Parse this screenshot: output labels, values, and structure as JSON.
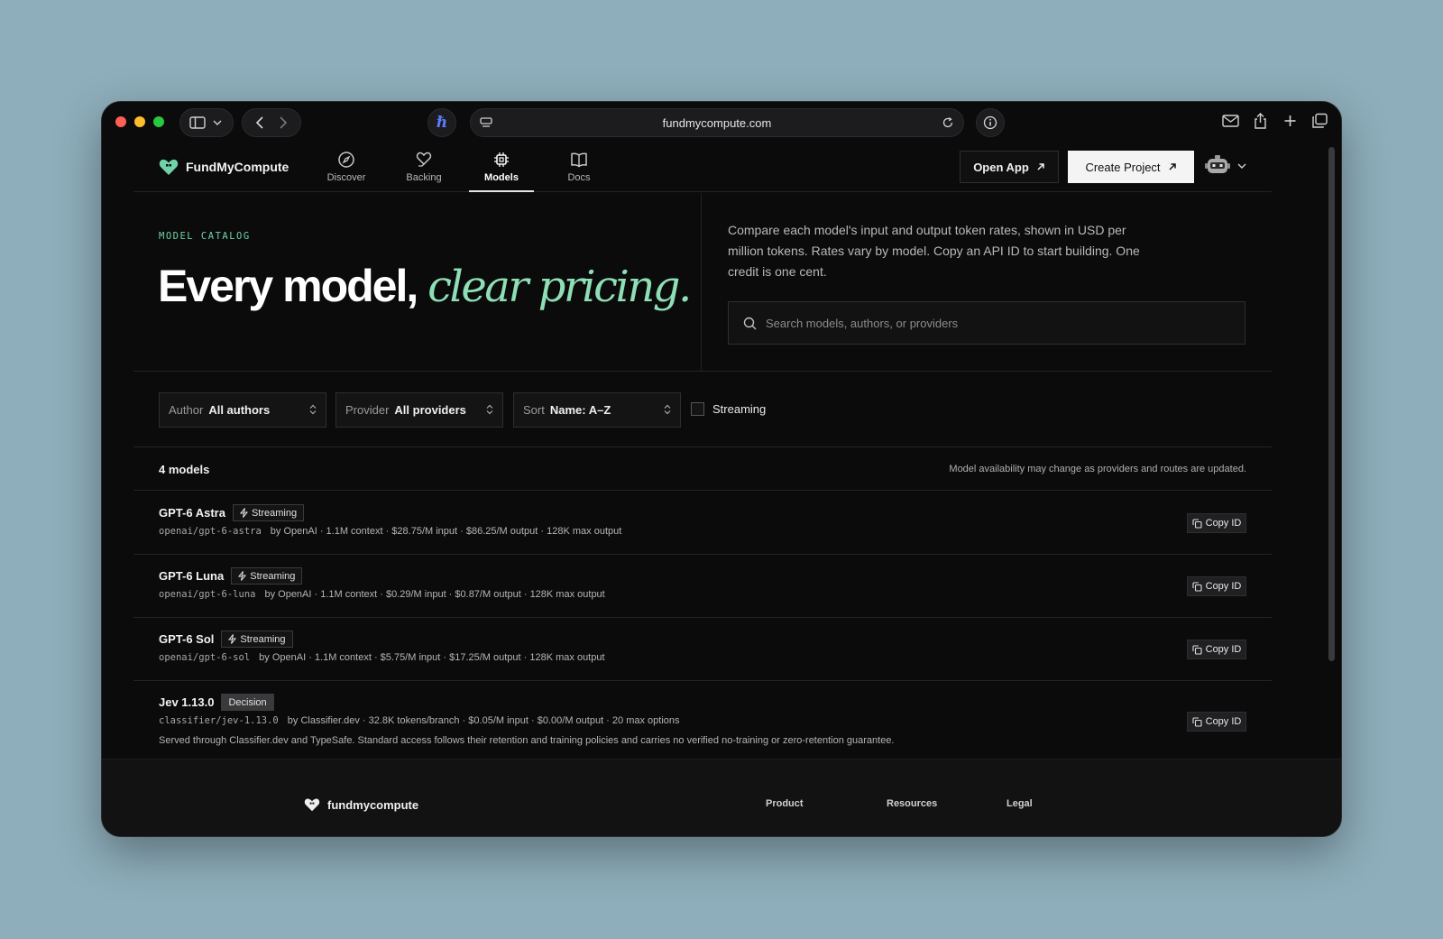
{
  "browser": {
    "url": "fundmycompute.com",
    "extension_glyph": "ℏ"
  },
  "nav": {
    "brand": "FundMyCompute",
    "items": [
      {
        "label": "Discover",
        "icon": "compass-icon"
      },
      {
        "label": "Backing",
        "icon": "heart-hand-icon"
      },
      {
        "label": "Models",
        "icon": "chip-icon",
        "active": true
      },
      {
        "label": "Docs",
        "icon": "book-icon"
      }
    ],
    "open_app": "Open App",
    "create_project": "Create Project"
  },
  "hero": {
    "eyebrow": "MODEL CATALOG",
    "headline_plain": "Every model, ",
    "headline_accent": "clear pricing.",
    "description": "Compare each model's input and output token rates, shown in USD per million tokens. Rates vary by model. Copy an API ID to start building. One credit is one cent.",
    "search_placeholder": "Search models, authors, or providers"
  },
  "filters": {
    "author": {
      "label": "Author",
      "value": "All authors"
    },
    "provider": {
      "label": "Provider",
      "value": "All providers"
    },
    "sort": {
      "label": "Sort",
      "value": "Name: A–Z"
    },
    "streaming_label": "Streaming"
  },
  "results": {
    "count": "4 models",
    "note": "Model availability may change as providers and routes are updated.",
    "copy_label": "Copy ID",
    "models": [
      {
        "name": "GPT-6 Astra",
        "badge": "Streaming",
        "id": "openai/gpt-6-astra",
        "meta": "by OpenAI · 1.1M context · $28.75/M input · $86.25/M output · 128K max output"
      },
      {
        "name": "GPT-6 Luna",
        "badge": "Streaming",
        "id": "openai/gpt-6-luna",
        "meta": "by OpenAI · 1.1M context · $0.29/M input · $0.87/M output · 128K max output"
      },
      {
        "name": "GPT-6 Sol",
        "badge": "Streaming",
        "id": "openai/gpt-6-sol",
        "meta": "by OpenAI · 1.1M context · $5.75/M input · $17.25/M output · 128K max output"
      },
      {
        "name": "Jev 1.13.0",
        "badge": "Decision",
        "id": "classifier/jev-1.13.0",
        "meta": "by Classifier.dev · 32.8K tokens/branch · $0.05/M input · $0.00/M output · 20 max options",
        "extra": "Served through Classifier.dev and TypeSafe. Standard access follows their retention and training policies and carries no verified no-training or zero-retention guarantee."
      }
    ]
  },
  "footer": {
    "brand": "fundmycompute",
    "links": [
      "Product",
      "Resources",
      "Legal"
    ]
  },
  "colors": {
    "accent_green": "#8fdfb6",
    "eyebrow_green": "#6fd3a7",
    "background": "#0b0b0c",
    "desktop": "#8eaebb"
  }
}
